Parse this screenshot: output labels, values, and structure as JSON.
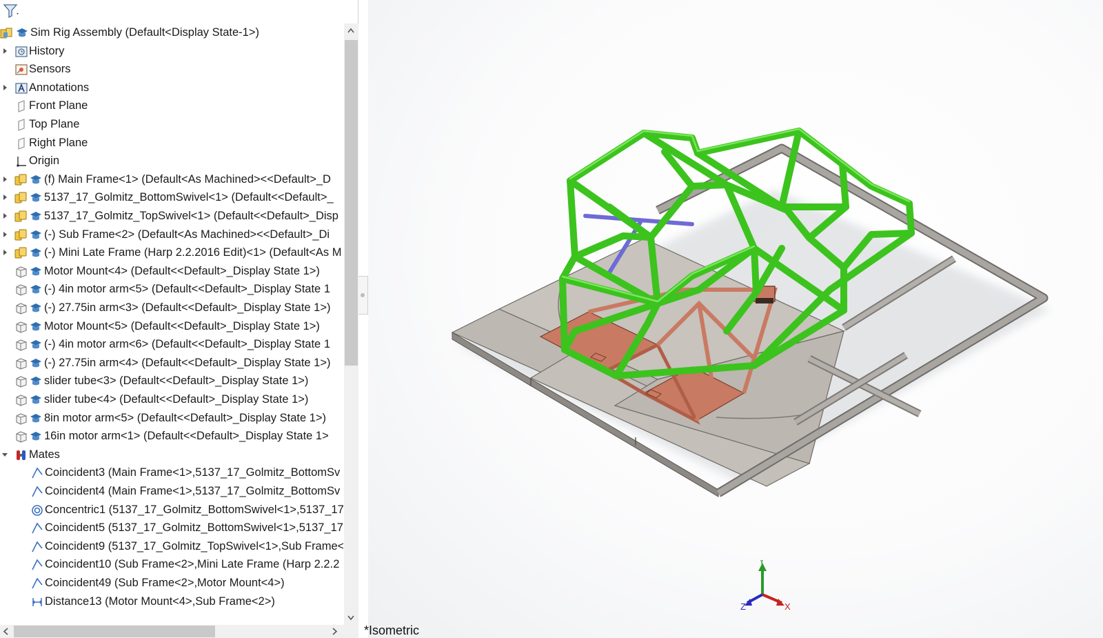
{
  "tree": {
    "root": {
      "label": "Sim Rig Assembly  (Default<Display State-1>)"
    },
    "items": [
      {
        "label": "History",
        "icon": "history-icon",
        "expand": "right",
        "indent": 0
      },
      {
        "label": "Sensors",
        "icon": "sensors-icon",
        "expand": "none",
        "indent": 0
      },
      {
        "label": "Annotations",
        "icon": "annotations-icon",
        "expand": "right",
        "indent": 0
      },
      {
        "label": "Front Plane",
        "icon": "plane-icon",
        "expand": "none",
        "indent": 0
      },
      {
        "label": "Top Plane",
        "icon": "plane-icon",
        "expand": "none",
        "indent": 0
      },
      {
        "label": "Right Plane",
        "icon": "plane-icon",
        "expand": "none",
        "indent": 0
      },
      {
        "label": "Origin",
        "icon": "origin-icon",
        "expand": "none",
        "indent": 0
      },
      {
        "label": "(f) Main Frame<1> (Default<As Machined><<Default>_D",
        "icon": "subassembly-icon",
        "expand": "right",
        "indent": 0
      },
      {
        "label": "5137_17_Golmitz_BottomSwivel<1> (Default<<Default>_",
        "icon": "subassembly-icon",
        "expand": "right",
        "indent": 0
      },
      {
        "label": "5137_17_Golmitz_TopSwivel<1> (Default<<Default>_Disp",
        "icon": "subassembly-icon",
        "expand": "right",
        "indent": 0
      },
      {
        "label": "(-) Sub Frame<2> (Default<As Machined><<Default>_Di",
        "icon": "subassembly-icon",
        "expand": "right",
        "indent": 0
      },
      {
        "label": "(-) Mini Late Frame (Harp 2.2.2016 Edit)<1> (Default<As M",
        "icon": "subassembly-icon",
        "expand": "right",
        "indent": 0
      },
      {
        "label": "Motor Mount<4> (Default<<Default>_Display State 1>)",
        "icon": "part-icon",
        "expand": "none",
        "indent": 0
      },
      {
        "label": "(-) 4in motor arm<5> (Default<<Default>_Display State 1",
        "icon": "part-icon",
        "expand": "none",
        "indent": 0
      },
      {
        "label": "(-) 27.75in arm<3> (Default<<Default>_Display State 1>)",
        "icon": "part-icon",
        "expand": "none",
        "indent": 0
      },
      {
        "label": "Motor Mount<5> (Default<<Default>_Display State 1>)",
        "icon": "part-icon",
        "expand": "none",
        "indent": 0
      },
      {
        "label": "(-) 4in motor arm<6> (Default<<Default>_Display State 1",
        "icon": "part-icon",
        "expand": "none",
        "indent": 0
      },
      {
        "label": "(-) 27.75in arm<4> (Default<<Default>_Display State 1>)",
        "icon": "part-icon",
        "expand": "none",
        "indent": 0
      },
      {
        "label": "slider tube<3> (Default<<Default>_Display State 1>)",
        "icon": "part-icon",
        "expand": "none",
        "indent": 0
      },
      {
        "label": "slider tube<4> (Default<<Default>_Display State 1>)",
        "icon": "part-icon",
        "expand": "none",
        "indent": 0
      },
      {
        "label": "8in motor arm<5> (Default<<Default>_Display State 1>)",
        "icon": "part-icon",
        "expand": "none",
        "indent": 0
      },
      {
        "label": "16in motor arm<1> (Default<<Default>_Display State 1>",
        "icon": "part-icon",
        "expand": "none",
        "indent": 0
      },
      {
        "label": "Mates",
        "icon": "mates-icon",
        "expand": "down",
        "indent": 0
      },
      {
        "label": "Coincident3 (Main Frame<1>,5137_17_Golmitz_BottomSv",
        "icon": "coincident-mate-icon",
        "expand": "none",
        "indent": 1
      },
      {
        "label": "Coincident4 (Main Frame<1>,5137_17_Golmitz_BottomSv",
        "icon": "coincident-mate-icon",
        "expand": "none",
        "indent": 1
      },
      {
        "label": "Concentric1 (5137_17_Golmitz_BottomSwivel<1>,5137_17",
        "icon": "concentric-mate-icon",
        "expand": "none",
        "indent": 1
      },
      {
        "label": "Coincident5 (5137_17_Golmitz_BottomSwivel<1>,5137_17",
        "icon": "coincident-mate-icon",
        "expand": "none",
        "indent": 1
      },
      {
        "label": "Coincident9 (5137_17_Golmitz_TopSwivel<1>,Sub Frame<",
        "icon": "coincident-mate-icon",
        "expand": "none",
        "indent": 1
      },
      {
        "label": "Coincident10 (Sub Frame<2>,Mini Late Frame (Harp 2.2.2",
        "icon": "coincident-mate-icon",
        "expand": "none",
        "indent": 1
      },
      {
        "label": "Coincident49 (Sub Frame<2>,Motor Mount<4>)",
        "icon": "coincident-mate-icon",
        "expand": "none",
        "indent": 1
      },
      {
        "label": "Distance13 (Motor Mount<4>,Sub Frame<2>)",
        "icon": "distance-mate-icon",
        "expand": "none",
        "indent": 1
      }
    ]
  },
  "viewport": {
    "view_label": "*Isometric",
    "triad": {
      "x": "X",
      "y": "Y",
      "z": "Z"
    }
  },
  "colors": {
    "frame_green": "#3cc31e",
    "sub_frame_red": "#c97a62",
    "base_grey": "#bdb8b2",
    "brace_blue": "#6d6bd6"
  }
}
